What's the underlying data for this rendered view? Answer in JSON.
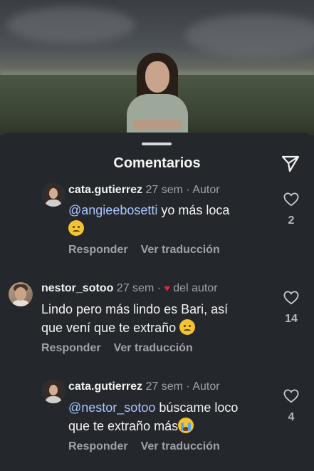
{
  "sheet": {
    "title": "Comentarios"
  },
  "comments": [
    {
      "user": "cata.gutierrez",
      "time": "27 sem",
      "separator": "·",
      "tag": "Autor",
      "mention": "@angieebosetti",
      "text_after_mention": " yo más loca",
      "emoji": "sad-face-emoji",
      "reply_label": "Responder",
      "translate_label": "Ver traducción",
      "likes": "2"
    },
    {
      "user": "nestor_sotoo",
      "time": "27 sem",
      "separator": "·",
      "tag": "del autor",
      "line1": "Lindo pero más lindo es Bari, así",
      "line2": "que vení que te extraño",
      "emoji": "sad-face-emoji",
      "reply_label": "Responder",
      "translate_label": "Ver traducción",
      "likes": "14"
    },
    {
      "user": "cata.gutierrez",
      "time": "27 sem",
      "separator": "·",
      "tag": "Autor",
      "mention": "@nestor_sotoo",
      "text_after_mention": " búscame loco",
      "line2": "que te extraño más",
      "emoji": "crying-face-emoji",
      "reply_label": "Responder",
      "translate_label": "Ver traducción",
      "likes": "4"
    }
  ],
  "colors": {
    "background": "#24272c",
    "mention": "#a8c6ff",
    "muted": "#9ea3a8",
    "heart_red": "#e0263a"
  }
}
